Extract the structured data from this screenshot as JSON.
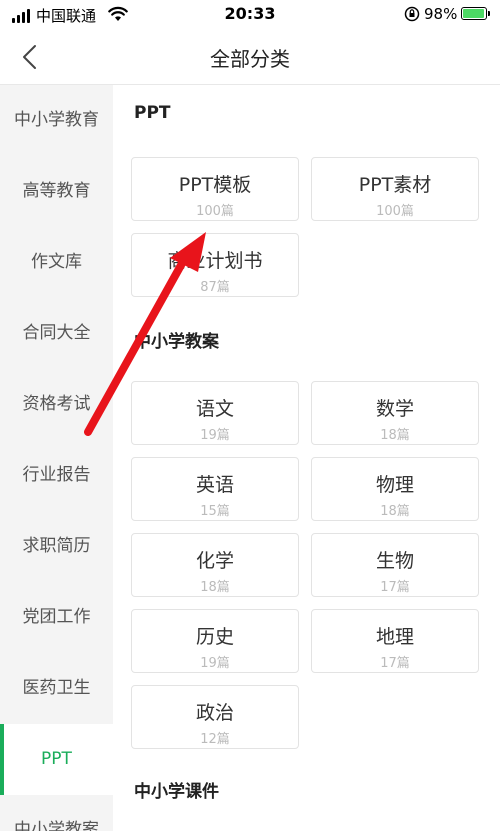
{
  "status_bar": {
    "carrier": "中国联通",
    "time": "20:33",
    "battery_percent": "98%",
    "battery_level": 0.98
  },
  "nav": {
    "title": "全部分类"
  },
  "sidebar": {
    "items": [
      {
        "label": "中小学教育"
      },
      {
        "label": "高等教育"
      },
      {
        "label": "作文库"
      },
      {
        "label": "合同大全"
      },
      {
        "label": "资格考试"
      },
      {
        "label": "行业报告"
      },
      {
        "label": "求职简历"
      },
      {
        "label": "党团工作"
      },
      {
        "label": "医药卫生"
      },
      {
        "label": "PPT"
      },
      {
        "label": "中小学教案"
      }
    ],
    "active_index": 9
  },
  "sections": [
    {
      "title": "PPT",
      "cards": [
        {
          "name": "PPT模板",
          "count": "100篇"
        },
        {
          "name": "PPT素材",
          "count": "100篇"
        },
        {
          "name": "商业计划书",
          "count": "87篇"
        }
      ]
    },
    {
      "title": "中小学教案",
      "cards": [
        {
          "name": "语文",
          "count": "19篇"
        },
        {
          "name": "数学",
          "count": "18篇"
        },
        {
          "name": "英语",
          "count": "15篇"
        },
        {
          "name": "物理",
          "count": "18篇"
        },
        {
          "name": "化学",
          "count": "18篇"
        },
        {
          "name": "生物",
          "count": "17篇"
        },
        {
          "name": "历史",
          "count": "19篇"
        },
        {
          "name": "地理",
          "count": "17篇"
        },
        {
          "name": "政治",
          "count": "12篇"
        }
      ]
    },
    {
      "title": "中小学课件",
      "cards": []
    }
  ],
  "colors": {
    "accent": "#1aad5a",
    "annotation_arrow": "#e8141b"
  },
  "icons": {
    "back": "chevron-left-icon",
    "wifi": "wifi-icon",
    "rotation_lock": "rotation-lock-icon",
    "battery": "battery-icon"
  }
}
